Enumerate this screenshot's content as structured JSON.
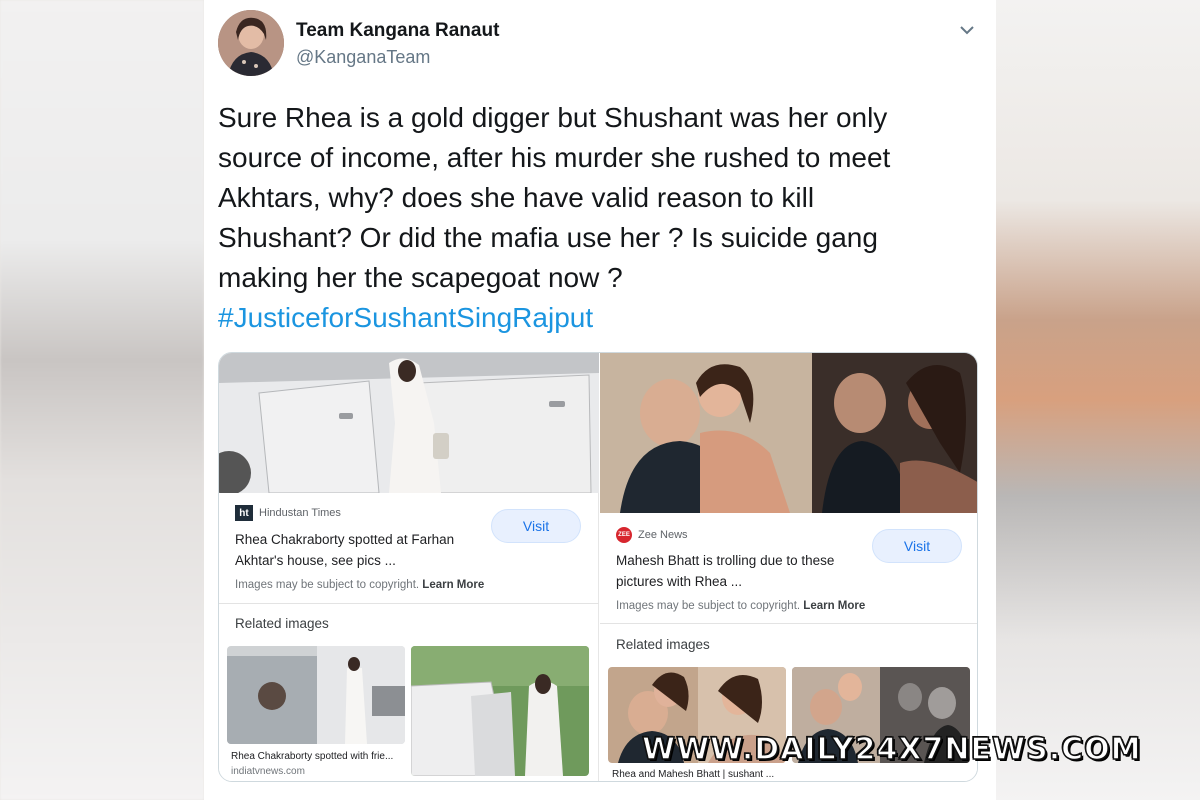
{
  "tweet": {
    "display_name": "Team Kangana Ranaut",
    "handle": "@KanganaTeam",
    "text_lines": [
      "Sure Rhea is a gold digger but Shushant was her only",
      "source of income, after his murder she rushed to meet",
      "Akhtars, why? does she have valid reason to kill",
      "Shushant? Or did the mafia use her ? Is suicide gang",
      "making her the scapegoat now ?"
    ],
    "hashtag": "#JusticeforSushantSingRajput"
  },
  "left_card": {
    "source_logo": "ht",
    "source_name": "Hindustan Times",
    "title_lines": [
      "Rhea Chakraborty spotted at Farhan",
      "Akhtar's house, see pics ..."
    ],
    "visit_label": "Visit",
    "copyright_text": "Images may be subject to copyright.",
    "learn_more": "Learn More",
    "related_label": "Related images",
    "related_caption": "Rhea Chakraborty spotted with frie...",
    "related_source": "indiatvnews.com"
  },
  "right_card": {
    "source_logo": "ZEE",
    "source_name": "Zee News",
    "title_lines": [
      "Mahesh Bhatt is trolling due to these",
      "pictures with Rhea ..."
    ],
    "visit_label": "Visit",
    "copyright_text": "Images may be subject to copyright.",
    "learn_more": "Learn More",
    "related_label": "Related images",
    "related_caption": "Rhea and Mahesh Bhatt | sushant ..."
  },
  "watermark": "WWW.DAILY24X7NEWS.COM",
  "colors": {
    "hashtag": "#1b95e0",
    "visit_bg": "#e8f0fe",
    "visit_text": "#1a73e8",
    "ht_logo": "#1f2d3a",
    "zee_logo": "#d7262e"
  }
}
